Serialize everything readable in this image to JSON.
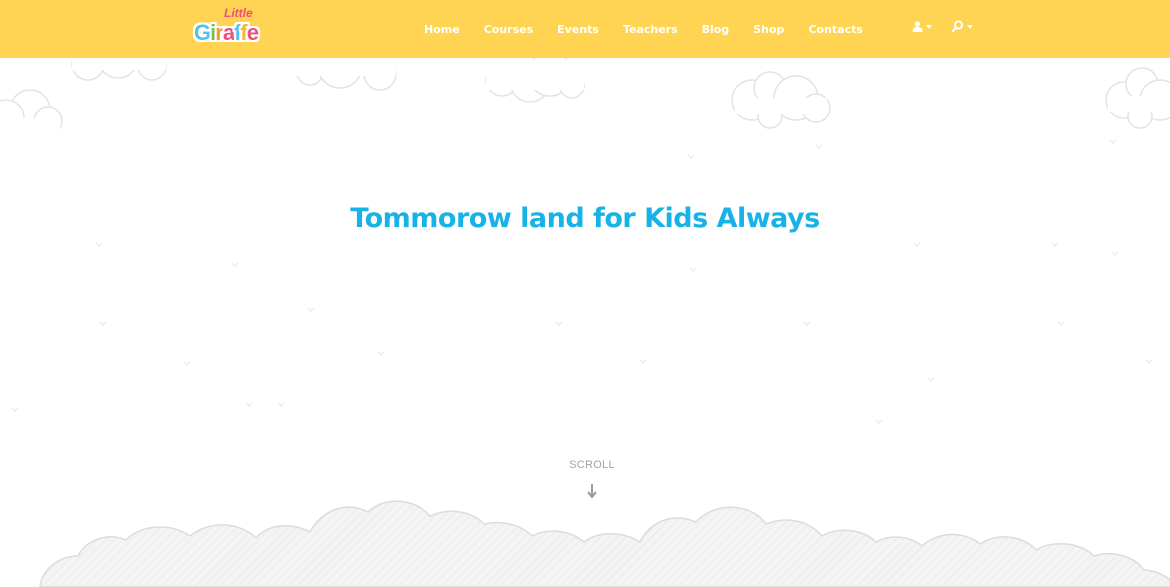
{
  "brand": {
    "small": "Little",
    "letters": [
      "G",
      "i",
      "r",
      "a",
      "f",
      "f",
      "e"
    ],
    "letter_colors": [
      "#4fc3ef",
      "#7cc04a",
      "#f2973b",
      "#ef4f7a",
      "#4fc3ef",
      "#f7b731",
      "#ef4f7a"
    ]
  },
  "nav": {
    "items": [
      "Home",
      "Courses",
      "Events",
      "Teachers",
      "Blog",
      "Shop",
      "Contacts"
    ]
  },
  "header_icons": [
    "user-icon",
    "search-icon"
  ],
  "hero": {
    "title": "Tommorow land for Kids Always"
  },
  "scroll": {
    "label": "SCROLL"
  },
  "colors": {
    "header_bg": "#ffd452",
    "title": "#17b3e6",
    "cloud_outline": "#e6e6e6",
    "ground": "#f2f2f2"
  }
}
